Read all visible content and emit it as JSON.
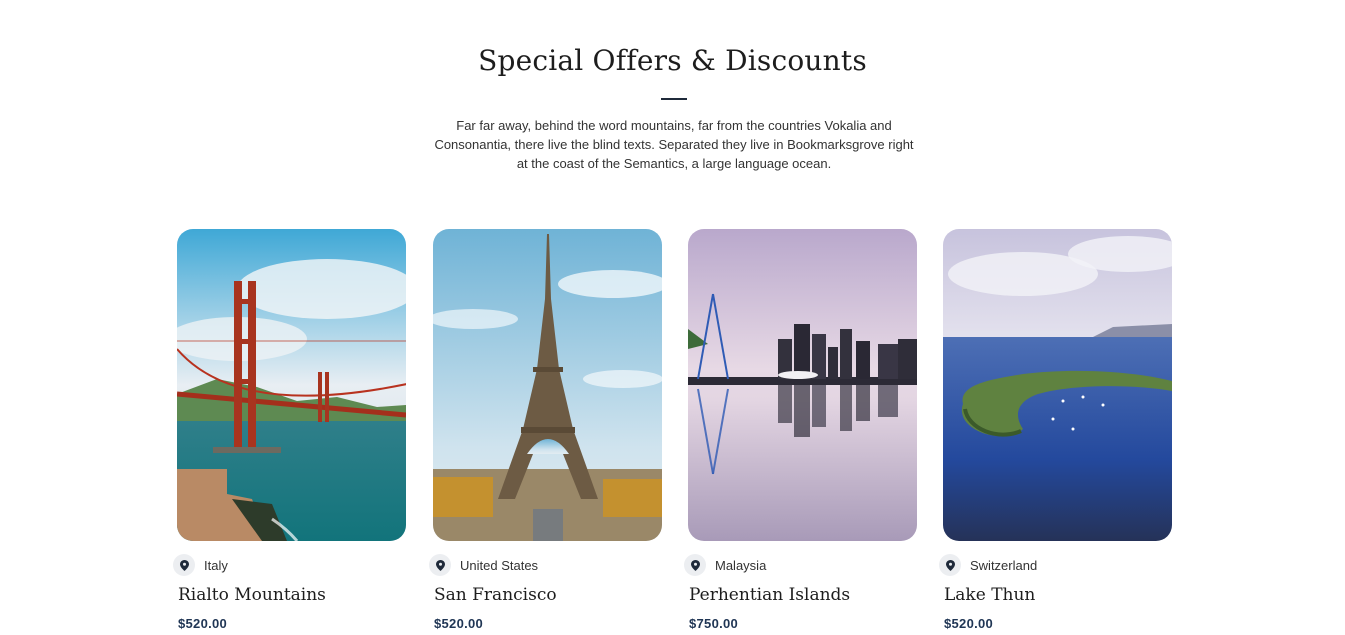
{
  "header": {
    "title": "Special Offers & Discounts",
    "description": "Far far away, behind the word mountains, far from the countries Vokalia and Consonantia, there live the blind texts. Separated they live in Bookmarksgrove right at the coast of the Semantics, a large language ocean."
  },
  "colors": {
    "accent": "#1f3554",
    "pin_bg": "#eceef1"
  },
  "offers": [
    {
      "country": "Italy",
      "name": "Rialto Mountains",
      "price": "$520.00",
      "image": "golden-gate-bridge-photo"
    },
    {
      "country": "United States",
      "name": "San Francisco",
      "price": "$520.00",
      "image": "eiffel-tower-photo"
    },
    {
      "country": "Malaysia",
      "name": "Perhentian Islands",
      "price": "$750.00",
      "image": "city-skyline-reflection-photo"
    },
    {
      "country": "Switzerland",
      "name": "Lake Thun",
      "price": "$520.00",
      "image": "crescent-island-photo"
    }
  ]
}
